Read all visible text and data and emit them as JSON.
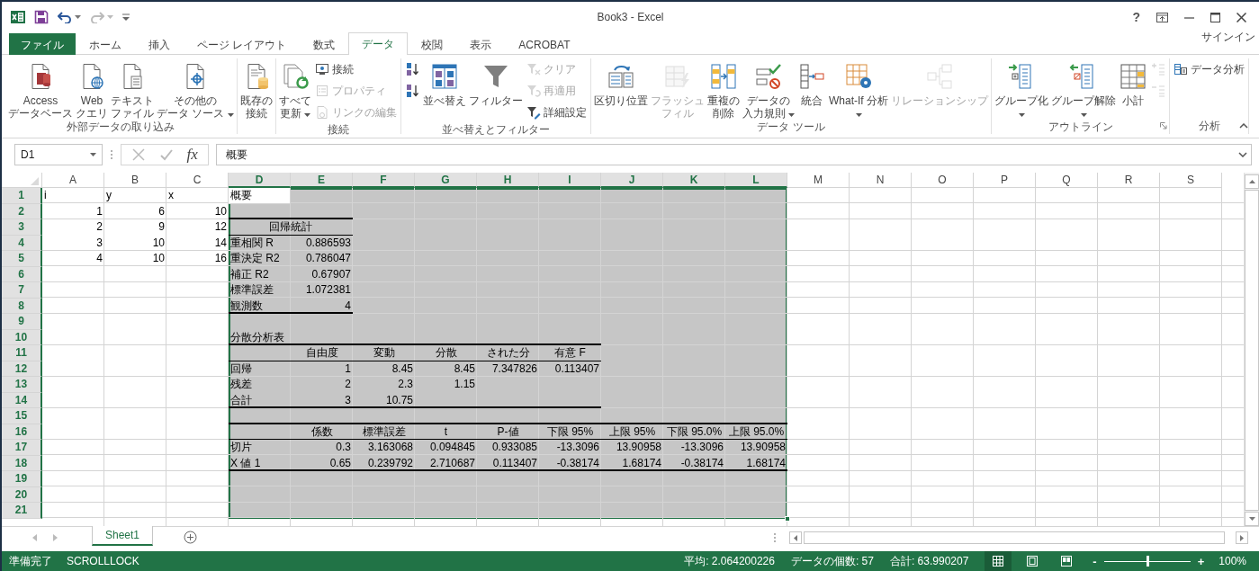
{
  "window": {
    "title": "Book3 - Excel",
    "help": "?"
  },
  "quick_access": {
    "undo": {
      "disabled": false
    },
    "redo": {
      "disabled": true
    }
  },
  "tabs": [
    {
      "label": "ファイル",
      "kind": "file",
      "selected": false
    },
    {
      "label": "ホーム",
      "kind": "tab",
      "selected": false
    },
    {
      "label": "挿入",
      "kind": "tab",
      "selected": false
    },
    {
      "label": "ページ レイアウト",
      "kind": "tab",
      "selected": false
    },
    {
      "label": "数式",
      "kind": "tab",
      "selected": false
    },
    {
      "label": "データ",
      "kind": "tab",
      "selected": true
    },
    {
      "label": "校閲",
      "kind": "tab",
      "selected": false
    },
    {
      "label": "表示",
      "kind": "tab",
      "selected": false
    },
    {
      "label": "ACROBAT",
      "kind": "tab",
      "selected": false
    }
  ],
  "sign_in": "サインイン",
  "ribbon": {
    "groups": [
      {
        "label": "外部データの取り込み",
        "launcher": false,
        "items": [
          {
            "kind": "large",
            "lines": [
              "Access",
              "データベース"
            ],
            "disabled": false,
            "dropdown": false
          },
          {
            "kind": "large",
            "lines": [
              "Web",
              "クエリ"
            ],
            "disabled": false,
            "dropdown": false
          },
          {
            "kind": "large",
            "lines": [
              "テキスト",
              "ファイル"
            ],
            "disabled": false,
            "dropdown": false
          },
          {
            "kind": "large",
            "lines": [
              "その他の",
              "データ ソース"
            ],
            "disabled": false,
            "dropdown": true
          }
        ]
      },
      {
        "launcher": false,
        "items": [
          {
            "kind": "large",
            "lines": [
              "既存の",
              "接続"
            ],
            "disabled": false,
            "dropdown": false
          }
        ]
      },
      {
        "label": "接続",
        "launcher": false,
        "items": [
          {
            "kind": "large",
            "lines": [
              "すべて",
              "更新"
            ],
            "disabled": false,
            "dropdown": true
          },
          {
            "kind": "small",
            "lines": [
              "接続"
            ],
            "disabled": false,
            "dropdown": false
          },
          {
            "kind": "small",
            "lines": [
              "プロパティ"
            ],
            "disabled": true,
            "dropdown": false
          },
          {
            "kind": "small",
            "lines": [
              "リンクの編集"
            ],
            "disabled": true,
            "dropdown": false
          }
        ]
      },
      {
        "label": "並べ替えとフィルター",
        "launcher": false,
        "items": [
          {
            "kind": "small",
            "disabled": false,
            "dropdown": false
          },
          {
            "kind": "small",
            "disabled": false,
            "dropdown": false
          },
          {
            "kind": "large",
            "lines": [
              "並べ替え"
            ],
            "disabled": false,
            "dropdown": false
          },
          {
            "kind": "large",
            "lines": [
              "フィルター"
            ],
            "disabled": false,
            "dropdown": false
          },
          {
            "kind": "small",
            "lines": [
              "クリア"
            ],
            "disabled": true,
            "dropdown": false
          },
          {
            "kind": "small",
            "lines": [
              "再適用"
            ],
            "disabled": true,
            "dropdown": false
          },
          {
            "kind": "small",
            "lines": [
              "詳細設定"
            ],
            "disabled": false,
            "dropdown": false
          }
        ]
      },
      {
        "label": "データ ツール",
        "launcher": false,
        "items": [
          {
            "kind": "large",
            "lines": [
              "区切り位置"
            ],
            "disabled": false,
            "dropdown": false
          },
          {
            "kind": "large",
            "lines": [
              "フラッシュ",
              "フィル"
            ],
            "disabled": true,
            "dropdown": false
          },
          {
            "kind": "large",
            "lines": [
              "重複の",
              "削除"
            ],
            "disabled": false,
            "dropdown": false
          },
          {
            "kind": "large",
            "lines": [
              "データの",
              "入力規則"
            ],
            "disabled": false,
            "dropdown": true
          },
          {
            "kind": "large",
            "lines": [
              "統合"
            ],
            "disabled": false,
            "dropdown": false
          },
          {
            "kind": "large",
            "lines": [
              "What-If 分析"
            ],
            "disabled": false,
            "dropdown": true
          },
          {
            "kind": "large",
            "lines": [
              "リレーションシップ"
            ],
            "disabled": true,
            "dropdown": false
          }
        ]
      },
      {
        "label": "アウトライン",
        "launcher": true,
        "items": [
          {
            "kind": "large",
            "lines": [
              "グループ化"
            ],
            "disabled": false,
            "dropdown": true
          },
          {
            "kind": "large",
            "lines": [
              "グループ解除"
            ],
            "disabled": false,
            "dropdown": true
          },
          {
            "kind": "large",
            "lines": [
              "小計"
            ],
            "disabled": false,
            "dropdown": false
          },
          {
            "kind": "small",
            "disabled": true,
            "dropdown": false
          },
          {
            "kind": "small",
            "disabled": true,
            "dropdown": false
          }
        ]
      },
      {
        "label": "分析",
        "launcher": false,
        "items": [
          {
            "kind": "small",
            "lines": [
              "データ分析"
            ],
            "disabled": false,
            "dropdown": false
          }
        ]
      }
    ]
  },
  "formula_bar": {
    "name_box": "D1",
    "function_button": "fx",
    "formula": "概要"
  },
  "sheet": {
    "columns": [
      {
        "label": "A",
        "selected": false
      },
      {
        "label": "B",
        "selected": false
      },
      {
        "label": "C",
        "selected": false
      },
      {
        "label": "D",
        "selected": true
      },
      {
        "label": "E",
        "selected": true
      },
      {
        "label": "F",
        "selected": true
      },
      {
        "label": "G",
        "selected": true
      },
      {
        "label": "H",
        "selected": true
      },
      {
        "label": "I",
        "selected": true
      },
      {
        "label": "J",
        "selected": true
      },
      {
        "label": "K",
        "selected": true
      },
      {
        "label": "L",
        "selected": true
      },
      {
        "label": "M",
        "selected": false
      },
      {
        "label": "N",
        "selected": false
      },
      {
        "label": "O",
        "selected": false
      },
      {
        "label": "P",
        "selected": false
      },
      {
        "label": "Q",
        "selected": false
      },
      {
        "label": "R",
        "selected": false
      },
      {
        "label": "S",
        "selected": false
      }
    ],
    "rows": [
      {
        "header": "1",
        "selected": true,
        "cells": [
          {
            "text": "i",
            "kind": "text"
          },
          {
            "text": "y",
            "kind": "text"
          },
          {
            "text": "x",
            "kind": "text"
          },
          {
            "text": "概要",
            "kind": "text",
            "active": true
          }
        ]
      },
      {
        "header": "2",
        "selected": true,
        "cells": [
          {
            "text": "1",
            "kind": "number"
          },
          {
            "text": "6",
            "kind": "number"
          },
          {
            "text": "10",
            "kind": "number"
          },
          {
            "rule_below": true,
            "heavy": true
          },
          {
            "rule_below": true,
            "heavy": true
          }
        ]
      },
      {
        "header": "3",
        "selected": true,
        "cells": [
          {
            "text": "2",
            "kind": "number"
          },
          {
            "text": "9",
            "kind": "number"
          },
          {
            "text": "12",
            "kind": "number"
          },
          {
            "text": "回帰統計",
            "kind": "heading",
            "merged": true,
            "rule_below": true,
            "heavy": false
          },
          null
        ]
      },
      {
        "header": "4",
        "selected": true,
        "cells": [
          {
            "text": "3",
            "kind": "number"
          },
          {
            "text": "10",
            "kind": "number"
          },
          {
            "text": "14",
            "kind": "number"
          },
          {
            "text": "重相関 R",
            "kind": "text"
          },
          {
            "text": "0.886593",
            "kind": "number"
          }
        ]
      },
      {
        "header": "5",
        "selected": true,
        "cells": [
          {
            "text": "4",
            "kind": "number"
          },
          {
            "text": "10",
            "kind": "number"
          },
          {
            "text": "16",
            "kind": "number"
          },
          {
            "text": "重決定 R2",
            "kind": "text"
          },
          {
            "text": "0.786047",
            "kind": "number"
          }
        ]
      },
      {
        "header": "6",
        "selected": true,
        "cells": [
          null,
          null,
          null,
          {
            "text": "補正 R2",
            "kind": "text"
          },
          {
            "text": "0.67907",
            "kind": "number"
          }
        ]
      },
      {
        "header": "7",
        "selected": true,
        "cells": [
          null,
          null,
          null,
          {
            "text": "標準誤差",
            "kind": "text"
          },
          {
            "text": "1.072381",
            "kind": "number"
          }
        ]
      },
      {
        "header": "8",
        "selected": true,
        "cells": [
          null,
          null,
          null,
          {
            "text": "観測数",
            "kind": "text",
            "rule_below": true,
            "heavy": true
          },
          {
            "text": "4",
            "kind": "number",
            "rule_below": true,
            "heavy": true
          }
        ]
      },
      {
        "header": "9",
        "selected": true
      },
      {
        "header": "10",
        "selected": true,
        "cells": [
          null,
          null,
          null,
          {
            "text": "分散分析表",
            "kind": "text",
            "rule_below": true,
            "heavy": true
          },
          {
            "rule_below": true,
            "heavy": true
          },
          {
            "rule_below": true,
            "heavy": true
          },
          {
            "rule_below": true,
            "heavy": true
          },
          {
            "rule_below": true,
            "heavy": true
          },
          {
            "rule_below": true,
            "heavy": true
          }
        ]
      },
      {
        "header": "11",
        "selected": true,
        "cells": [
          null,
          null,
          null,
          {
            "rule_below": true,
            "heavy": false
          },
          {
            "text": "自由度",
            "kind": "heading",
            "rule_below": true,
            "heavy": false
          },
          {
            "text": "変動",
            "kind": "heading",
            "rule_below": true,
            "heavy": false
          },
          {
            "text": "分散",
            "kind": "heading",
            "rule_below": true,
            "heavy": false
          },
          {
            "text": "された分",
            "kind": "heading",
            "rule_below": true,
            "heavy": false
          },
          {
            "text": "有意 F",
            "kind": "heading",
            "rule_below": true,
            "heavy": false
          }
        ]
      },
      {
        "header": "12",
        "selected": true,
        "cells": [
          null,
          null,
          null,
          {
            "text": "回帰",
            "kind": "text"
          },
          {
            "text": "1",
            "kind": "number"
          },
          {
            "text": "8.45",
            "kind": "number"
          },
          {
            "text": "8.45",
            "kind": "number"
          },
          {
            "text": "7.347826",
            "kind": "number"
          },
          {
            "text": "0.113407",
            "kind": "number"
          }
        ]
      },
      {
        "header": "13",
        "selected": true,
        "cells": [
          null,
          null,
          null,
          {
            "text": "残差",
            "kind": "text"
          },
          {
            "text": "2",
            "kind": "number"
          },
          {
            "text": "2.3",
            "kind": "number"
          },
          {
            "text": "1.15",
            "kind": "number"
          }
        ]
      },
      {
        "header": "14",
        "selected": true,
        "cells": [
          null,
          null,
          null,
          {
            "text": "合計",
            "kind": "text",
            "rule_below": true,
            "heavy": true
          },
          {
            "text": "3",
            "kind": "number",
            "rule_below": true,
            "heavy": true
          },
          {
            "text": "10.75",
            "kind": "number",
            "rule_below": true,
            "heavy": true
          },
          {
            "rule_below": true,
            "heavy": true
          },
          {
            "rule_below": true,
            "heavy": true
          },
          {
            "rule_below": true,
            "heavy": true
          }
        ]
      },
      {
        "header": "15",
        "selected": true,
        "cells": [
          null,
          null,
          null,
          {
            "rule_below": true,
            "heavy": true
          },
          {
            "rule_below": true,
            "heavy": true
          },
          {
            "rule_below": true,
            "heavy": true
          },
          {
            "rule_below": true,
            "heavy": true
          },
          {
            "rule_below": true,
            "heavy": true
          },
          {
            "rule_below": true,
            "heavy": true
          },
          {
            "rule_below": true,
            "heavy": true
          },
          {
            "rule_below": true,
            "heavy": true
          },
          {
            "rule_below": true,
            "heavy": true
          }
        ]
      },
      {
        "header": "16",
        "selected": true,
        "cells": [
          null,
          null,
          null,
          {
            "rule_below": true,
            "heavy": false
          },
          {
            "text": "係数",
            "kind": "heading",
            "rule_below": true,
            "heavy": false
          },
          {
            "text": "標準誤差",
            "kind": "heading",
            "rule_below": true,
            "heavy": false
          },
          {
            "text": "t",
            "kind": "heading",
            "rule_below": true,
            "heavy": false
          },
          {
            "text": "P-値",
            "kind": "heading",
            "rule_below": true,
            "heavy": false
          },
          {
            "text": "下限 95%",
            "kind": "heading",
            "rule_below": true,
            "heavy": false
          },
          {
            "text": "上限 95%",
            "kind": "heading",
            "rule_below": true,
            "heavy": false
          },
          {
            "text": "下限 95.0%",
            "kind": "heading",
            "rule_below": true,
            "heavy": false
          },
          {
            "text": "上限 95.0%",
            "kind": "heading",
            "rule_below": true,
            "heavy": false
          }
        ]
      },
      {
        "header": "17",
        "selected": true,
        "cells": [
          null,
          null,
          null,
          {
            "text": "切片",
            "kind": "text"
          },
          {
            "text": "0.3",
            "kind": "number"
          },
          {
            "text": "3.163068",
            "kind": "number"
          },
          {
            "text": "0.094845",
            "kind": "number"
          },
          {
            "text": "0.933085",
            "kind": "number"
          },
          {
            "text": "-13.3096",
            "kind": "number"
          },
          {
            "text": "13.90958",
            "kind": "number"
          },
          {
            "text": "-13.3096",
            "kind": "number"
          },
          {
            "text": "13.90958",
            "kind": "number"
          }
        ]
      },
      {
        "header": "18",
        "selected": true,
        "cells": [
          null,
          null,
          null,
          {
            "text": "X 値 1",
            "kind": "text",
            "rule_below": true,
            "heavy": true
          },
          {
            "text": "0.65",
            "kind": "number",
            "rule_below": true,
            "heavy": true
          },
          {
            "text": "0.239792",
            "kind": "number",
            "rule_below": true,
            "heavy": true
          },
          {
            "text": "2.710687",
            "kind": "number",
            "rule_below": true,
            "heavy": true
          },
          {
            "text": "0.113407",
            "kind": "number",
            "rule_below": true,
            "heavy": true
          },
          {
            "text": "-0.38174",
            "kind": "number",
            "rule_below": true,
            "heavy": true
          },
          {
            "text": "1.68174",
            "kind": "number",
            "rule_below": true,
            "heavy": true
          },
          {
            "text": "-0.38174",
            "kind": "number",
            "rule_below": true,
            "heavy": true
          },
          {
            "text": "1.68174",
            "kind": "number",
            "rule_below": true,
            "heavy": true
          }
        ]
      },
      {
        "header": "19",
        "selected": true
      },
      {
        "header": "20",
        "selected": true
      },
      {
        "header": "21",
        "selected": true
      }
    ]
  },
  "sheet_tabs": [
    {
      "label": "Sheet1",
      "selected": true
    }
  ],
  "status_bar": {
    "ready": "準備完了",
    "scroll_lock": "SCROLLLOCK",
    "average": "平均: 2.064200226",
    "count": "データの個数: 57",
    "sum": "合計: 63.990207",
    "views": [
      {
        "kind": "normal",
        "selected": true
      },
      {
        "kind": "page_layout",
        "selected": false
      },
      {
        "kind": "page_break",
        "selected": false
      }
    ],
    "zoom": {
      "minus": "-",
      "plus": "+",
      "level": 0.5,
      "reading": "100%"
    }
  }
}
